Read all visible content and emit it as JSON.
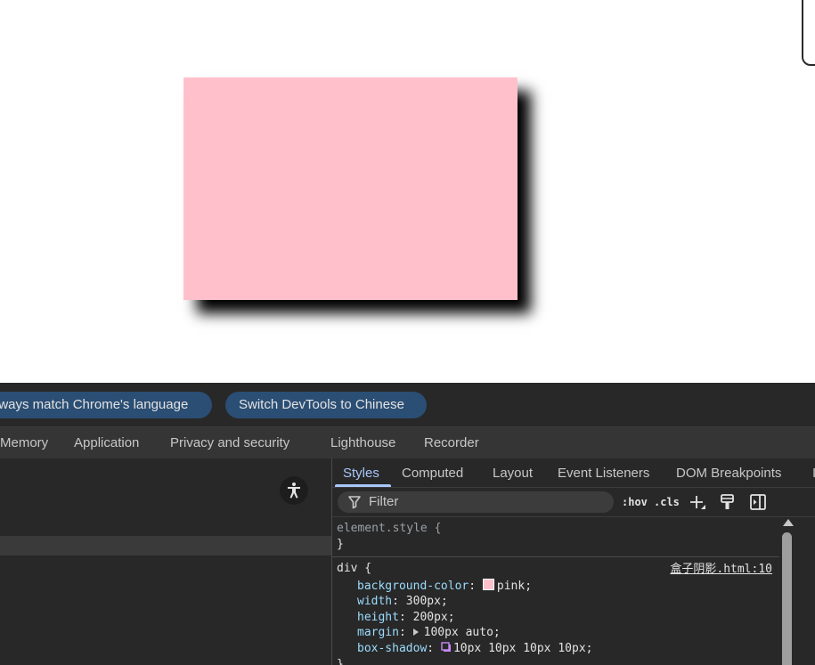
{
  "viewport": {
    "demo_box_color": "#ffc0cb"
  },
  "language_bar": {
    "match_button": "lways match Chrome's language",
    "switch_button": "Switch DevTools to Chinese"
  },
  "panel_tabs": [
    "Memory",
    "Application",
    "Privacy and security",
    "Lighthouse",
    "Recorder"
  ],
  "sidebar_tabs": [
    "Styles",
    "Computed",
    "Layout",
    "Event Listeners",
    "DOM Breakpoints",
    "I"
  ],
  "active_sidebar_tab": "Styles",
  "toolbar": {
    "filter_placeholder": "Filter",
    "hov_label": ":hov",
    "cls_label": ".cls",
    "icons": [
      "filter-icon",
      "add-rule-icon",
      "paint-icon",
      "toggle-sidebar-icon"
    ]
  },
  "styles": {
    "element_rule": {
      "selector": "element.style {",
      "close": "}"
    },
    "div_rule": {
      "selector": "div {",
      "source": "盒子阴影.html:10",
      "declarations": [
        {
          "prop": "background-color",
          "value": "pink;"
        },
        {
          "prop": "width",
          "value": "300px;"
        },
        {
          "prop": "height",
          "value": "200px;"
        },
        {
          "prop": "margin",
          "value": "100px auto;"
        },
        {
          "prop": "box-shadow",
          "value": "10px 10px 10px 10px;"
        }
      ],
      "close": "}"
    }
  },
  "colors": {
    "devtools_bg": "#282828",
    "accent": "#a8c7fa",
    "pill_bg": "#2b4e74",
    "property": "#9cdcfe"
  }
}
